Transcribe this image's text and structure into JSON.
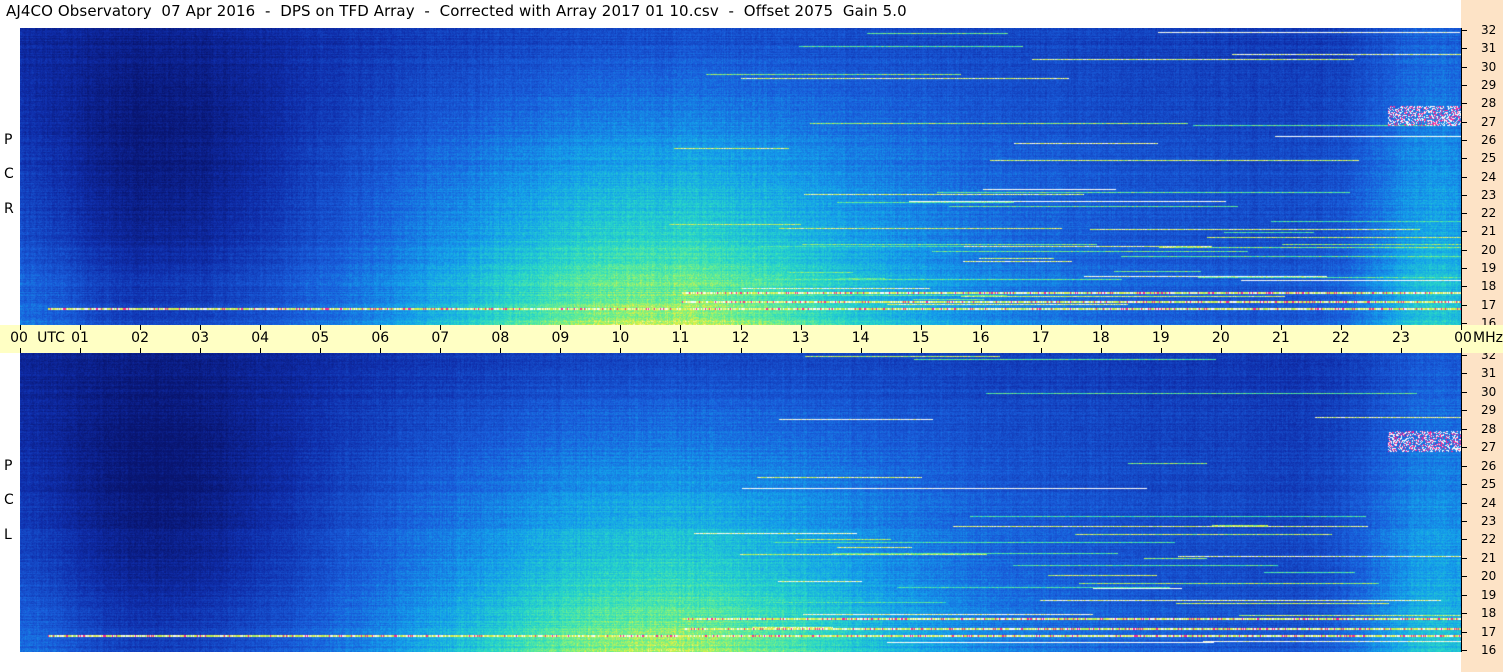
{
  "header": {
    "title": "AJ4CO Observatory  07 Apr 2016  -  DPS on TFD Array  -  Corrected with Array 2017 01 10.csv  -  Offset 2075  Gain 5.0"
  },
  "panels": [
    {
      "name": "RCP",
      "letters": [
        "P",
        "C",
        "R"
      ]
    },
    {
      "name": "LCP",
      "letters": [
        "P",
        "C",
        "L"
      ]
    }
  ],
  "time_axis": {
    "labels": [
      "00",
      "01",
      "02",
      "03",
      "04",
      "05",
      "06",
      "07",
      "08",
      "09",
      "10",
      "11",
      "12",
      "13",
      "14",
      "15",
      "16",
      "17",
      "18",
      "19",
      "20",
      "21",
      "22",
      "23",
      "00"
    ],
    "utc_label": "UTC",
    "mhz_label": "MHz"
  },
  "chart_data": {
    "type": "heatmap",
    "title": "AJ4CO Observatory  07 Apr 2016  -  DPS on TFD Array  -  Corrected with Array 2017 01 10.csv  -  Offset 2075  Gain 5.0",
    "xlabel": "UTC",
    "ylabel": "MHz",
    "x_ticks": [
      "00",
      "01",
      "02",
      "03",
      "04",
      "05",
      "06",
      "07",
      "08",
      "09",
      "10",
      "11",
      "12",
      "13",
      "14",
      "15",
      "16",
      "17",
      "18",
      "19",
      "20",
      "21",
      "22",
      "23",
      "00"
    ],
    "y_ticks": [
      32,
      31,
      30,
      29,
      28,
      27,
      26,
      25,
      24,
      23,
      22,
      21,
      20,
      19,
      18,
      17,
      16
    ],
    "xlim": [
      0,
      24
    ],
    "ylim": [
      16,
      32
    ],
    "series": [
      {
        "name": "RCP"
      },
      {
        "name": "LCP"
      }
    ],
    "colors": {
      "low": "#0a1a80",
      "mid": "#1e78e8",
      "high": "#3ee8c0",
      "peak": "#f0f040",
      "saturated": "#ff2080"
    }
  }
}
